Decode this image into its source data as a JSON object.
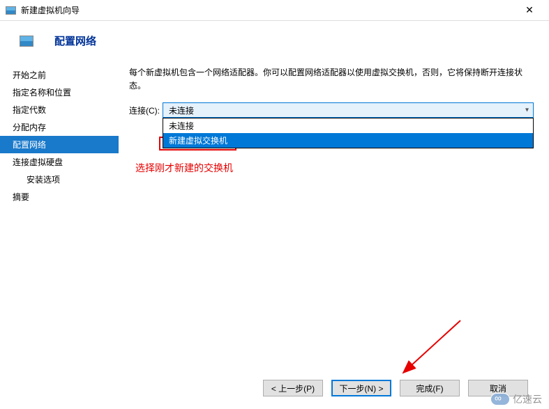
{
  "window": {
    "title": "新建虚拟机向导"
  },
  "header": {
    "title": "配置网络"
  },
  "sidebar": {
    "items": [
      {
        "label": "开始之前",
        "indent": false
      },
      {
        "label": "指定名称和位置",
        "indent": false
      },
      {
        "label": "指定代数",
        "indent": false
      },
      {
        "label": "分配内存",
        "indent": false
      },
      {
        "label": "配置网络",
        "indent": false
      },
      {
        "label": "连接虚拟硬盘",
        "indent": false
      },
      {
        "label": "安装选项",
        "indent": true
      },
      {
        "label": "摘要",
        "indent": false
      }
    ],
    "active_index": 4
  },
  "main": {
    "description": "每个新虚拟机包含一个网络适配器。你可以配置网络适配器以使用虚拟交换机，否则，它将保持断开连接状态。",
    "connection_label": "连接(C):",
    "combo_value": "未连接",
    "dropdown_options": [
      {
        "label": "未连接",
        "highlighted": false
      },
      {
        "label": "新建虚拟交换机",
        "highlighted": true
      }
    ]
  },
  "annotation": "选择刚才新建的交换机",
  "footer": {
    "prev": "< 上一步(P)",
    "next": "下一步(N) >",
    "finish": "完成(F)",
    "cancel": "取消"
  },
  "watermark": "亿速云",
  "colors": {
    "accent": "#0078d7",
    "highlight_red": "#e60000",
    "header_blue": "#003399"
  }
}
